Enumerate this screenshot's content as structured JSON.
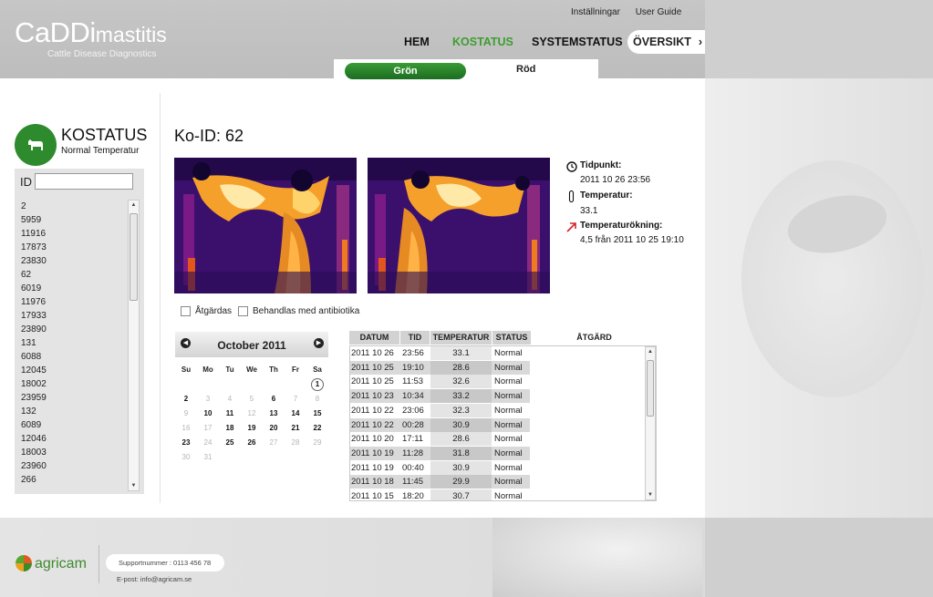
{
  "header": {
    "logo_main": "CaDDi",
    "logo_sub": "mastitis",
    "logo_tagline": "Cattle Disease Diagnostics",
    "top_links": [
      "Inställningar",
      "User Guide"
    ],
    "nav": {
      "hem": "HEM",
      "kostatus": "KOSTATUS",
      "systemstatus": "SYSTEMSTATUS",
      "oversikt": "ÖVERSIKT",
      "chevron": "›"
    },
    "subnav": {
      "green": "Grön",
      "red": "Röd"
    }
  },
  "status": {
    "title": "KOSTATUS",
    "subtitle": "Normal Temperatur",
    "color": "#2d8a2d"
  },
  "id_panel": {
    "label": "ID",
    "input_value": "",
    "ids": [
      "2",
      "5959",
      "11916",
      "17873",
      "23830",
      "62",
      "6019",
      "11976",
      "17933",
      "23890",
      "131",
      "6088",
      "12045",
      "18002",
      "23959",
      "132",
      "6089",
      "12046",
      "18003",
      "23960",
      "266"
    ]
  },
  "cow": {
    "title": "Ko-ID: 62"
  },
  "info": {
    "time_label": "Tidpunkt:",
    "time_value": "2011 10 26 23:56",
    "temp_label": "Temperatur:",
    "temp_value": "33.1",
    "rise_label": "Temperaturökning:",
    "rise_value": "4,5 från 2011 10 25 19:10"
  },
  "checkboxes": {
    "atgardas": "Åtgärdas",
    "antibiotika": "Behandlas med antibiotika"
  },
  "calendar": {
    "title": "October 2011",
    "weekdays": [
      "Su",
      "Mo",
      "Tu",
      "We",
      "Th",
      "Fr",
      "Sa"
    ],
    "days": [
      {
        "d": "",
        "dim": false
      },
      {
        "d": "",
        "dim": false
      },
      {
        "d": "",
        "dim": false
      },
      {
        "d": "",
        "dim": false
      },
      {
        "d": "",
        "dim": false
      },
      {
        "d": "",
        "dim": false
      },
      {
        "d": "1",
        "dim": false,
        "sel": true
      },
      {
        "d": "2",
        "dim": false
      },
      {
        "d": "3",
        "dim": true
      },
      {
        "d": "4",
        "dim": true
      },
      {
        "d": "5",
        "dim": true
      },
      {
        "d": "6",
        "dim": false
      },
      {
        "d": "7",
        "dim": true
      },
      {
        "d": "8",
        "dim": true
      },
      {
        "d": "9",
        "dim": true
      },
      {
        "d": "10",
        "dim": false
      },
      {
        "d": "11",
        "dim": false
      },
      {
        "d": "12",
        "dim": true
      },
      {
        "d": "13",
        "dim": false
      },
      {
        "d": "14",
        "dim": false
      },
      {
        "d": "15",
        "dim": false
      },
      {
        "d": "16",
        "dim": true
      },
      {
        "d": "17",
        "dim": true
      },
      {
        "d": "18",
        "dim": false
      },
      {
        "d": "19",
        "dim": false
      },
      {
        "d": "20",
        "dim": false
      },
      {
        "d": "21",
        "dim": false
      },
      {
        "d": "22",
        "dim": false
      },
      {
        "d": "23",
        "dim": false
      },
      {
        "d": "24",
        "dim": true
      },
      {
        "d": "25",
        "dim": false
      },
      {
        "d": "26",
        "dim": false
      },
      {
        "d": "27",
        "dim": true
      },
      {
        "d": "28",
        "dim": true
      },
      {
        "d": "29",
        "dim": true
      },
      {
        "d": "30",
        "dim": true
      },
      {
        "d": "31",
        "dim": true
      },
      {
        "d": "",
        "dim": false
      },
      {
        "d": "",
        "dim": false
      },
      {
        "d": "",
        "dim": false
      },
      {
        "d": "",
        "dim": false
      },
      {
        "d": "",
        "dim": false
      }
    ]
  },
  "table": {
    "headers": {
      "datum": "DATUM",
      "tid": "TID",
      "temperatur": "TEMPERATUR",
      "status": "STATUS",
      "atgard": "ÅTGÄRD"
    },
    "rows": [
      {
        "datum": "2011 10 26",
        "tid": "23:56",
        "temp": "33.1",
        "status": "Normal"
      },
      {
        "datum": "2011 10 25",
        "tid": "19:10",
        "temp": "28.6",
        "status": "Normal"
      },
      {
        "datum": "2011 10 25",
        "tid": "11:53",
        "temp": "32.6",
        "status": "Normal"
      },
      {
        "datum": "2011 10 23",
        "tid": "10:34",
        "temp": "33.2",
        "status": "Normal"
      },
      {
        "datum": "2011 10 22",
        "tid": "23:06",
        "temp": "32.3",
        "status": "Normal"
      },
      {
        "datum": "2011 10 22",
        "tid": "00:28",
        "temp": "30.9",
        "status": "Normal"
      },
      {
        "datum": "2011 10 20",
        "tid": "17:11",
        "temp": "28.6",
        "status": "Normal"
      },
      {
        "datum": "2011 10 19",
        "tid": "11:28",
        "temp": "31.8",
        "status": "Normal"
      },
      {
        "datum": "2011 10 19",
        "tid": "00:40",
        "temp": "30.9",
        "status": "Normal"
      },
      {
        "datum": "2011 10 18",
        "tid": "11:45",
        "temp": "29.9",
        "status": "Normal"
      },
      {
        "datum": "2011 10 15",
        "tid": "18:20",
        "temp": "30.7",
        "status": "Normal"
      }
    ]
  },
  "footer": {
    "brand": "agricam",
    "support": "Supportnummer : 0113 456 78",
    "email": "E-post: info@agricam.se"
  },
  "colors": {
    "accent_green": "#3d9d2f",
    "button_green": "#1b6d21",
    "alert_red": "#d2262a"
  }
}
